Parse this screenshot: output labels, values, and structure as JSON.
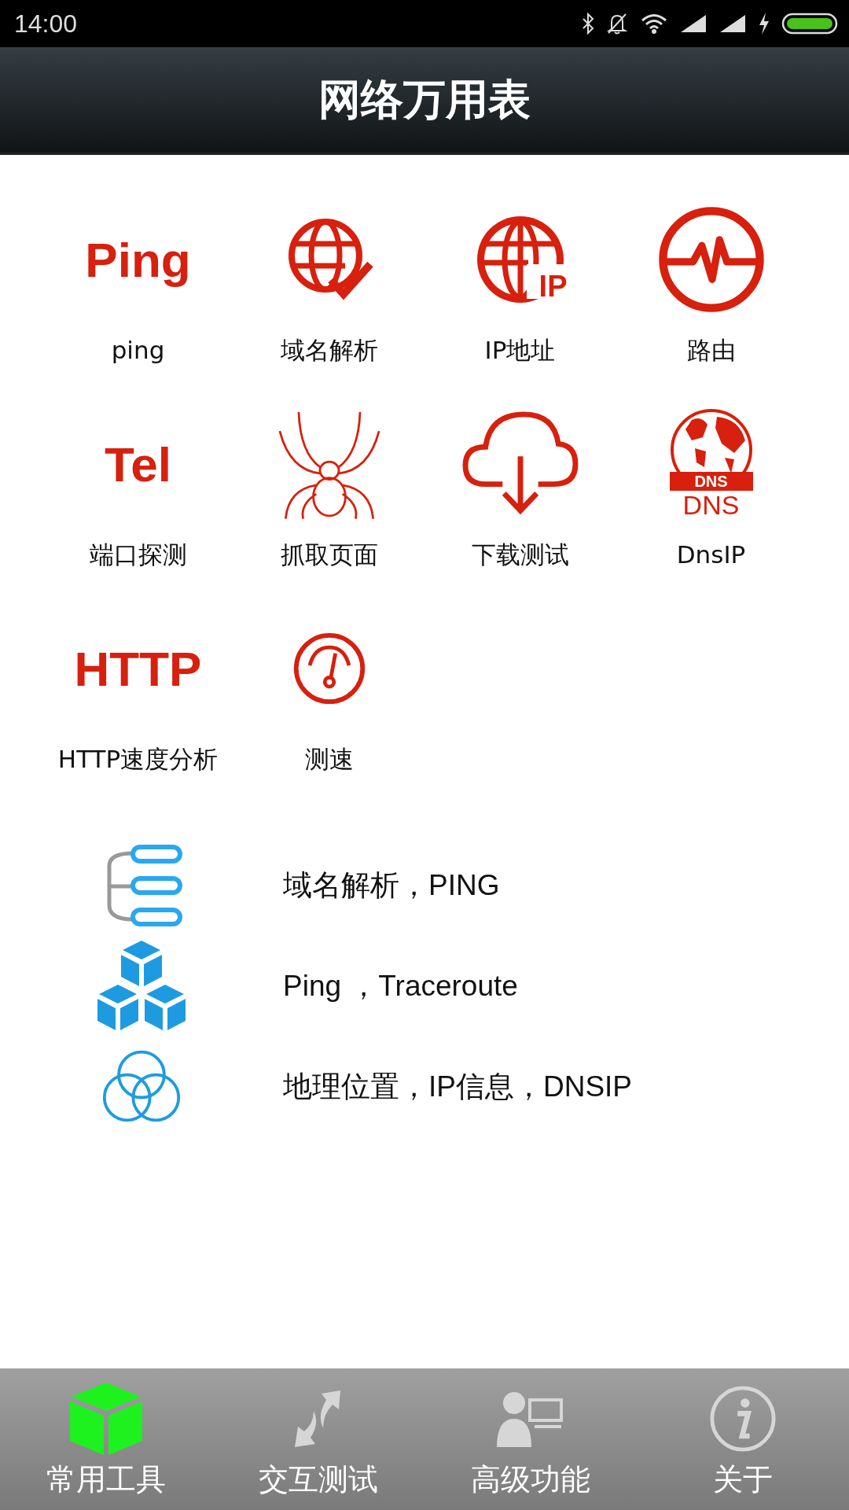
{
  "status_bar": {
    "time": "14:00"
  },
  "header": {
    "title": "网络万用表"
  },
  "tools": [
    {
      "label": "ping",
      "kind": "text",
      "icon_text": "Ping"
    },
    {
      "label": "域名解析",
      "kind": "globecheck"
    },
    {
      "label": "IP地址",
      "kind": "globeip",
      "icon_text": "IP"
    },
    {
      "label": "路由",
      "kind": "pulse"
    },
    {
      "label": "端口探测",
      "kind": "text",
      "icon_text": "Tel"
    },
    {
      "label": "抓取页面",
      "kind": "spider"
    },
    {
      "label": "下载测试",
      "kind": "download"
    },
    {
      "label": "DnsIP",
      "kind": "dns",
      "icon_text": "DNS",
      "icon_text2": "DNS"
    },
    {
      "label": "HTTP速度分析",
      "kind": "text",
      "icon_text": "HTTP"
    },
    {
      "label": "测速",
      "kind": "gauge"
    }
  ],
  "features": [
    {
      "text": "域名解析，PING",
      "kind": "tree"
    },
    {
      "text": "Ping ，Traceroute",
      "kind": "cubes"
    },
    {
      "text": "地理位置，IP信息，DNSIP",
      "kind": "rings"
    }
  ],
  "tabs": [
    {
      "label": "常用工具",
      "kind": "cube",
      "selected": true
    },
    {
      "label": "交互测试",
      "kind": "arrows",
      "selected": false
    },
    {
      "label": "高级功能",
      "kind": "person",
      "selected": false
    },
    {
      "label": "关于",
      "kind": "info",
      "selected": false
    }
  ]
}
